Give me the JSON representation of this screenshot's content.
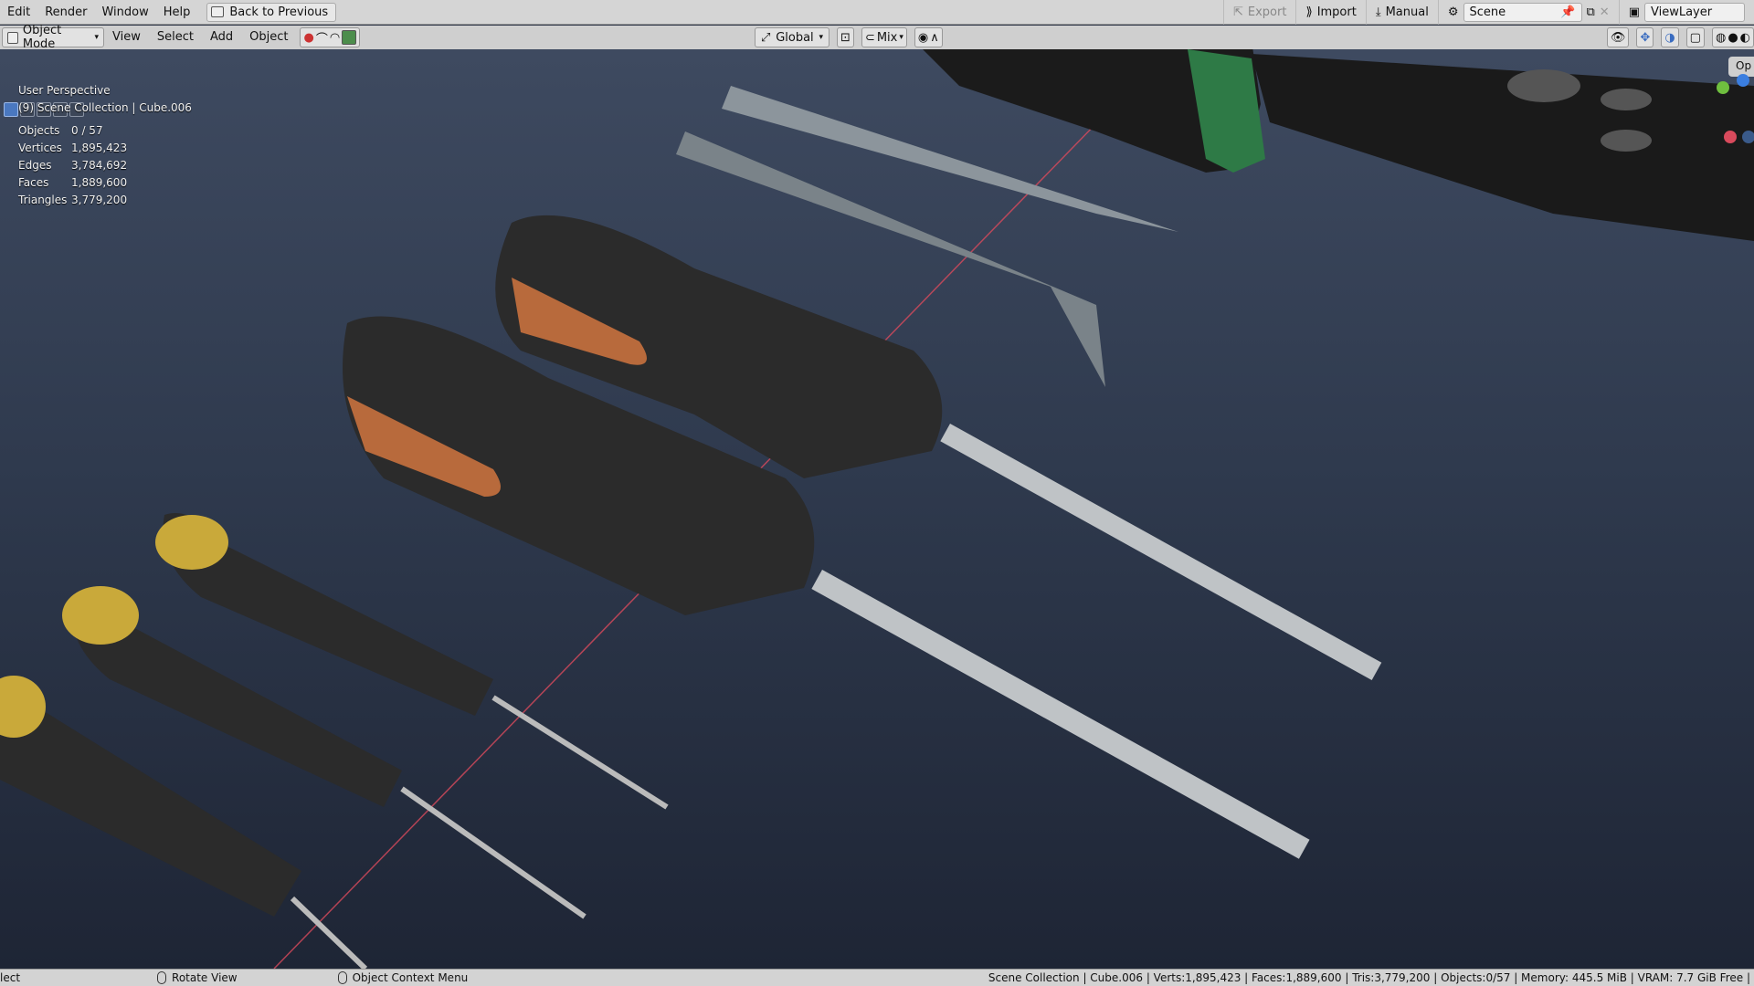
{
  "topbar": {
    "menus": [
      "Edit",
      "Render",
      "Window",
      "Help"
    ],
    "back_label": "Back to Previous",
    "export_label": "Export",
    "import_label": "Import",
    "manual_label": "Manual",
    "scene_name": "Scene",
    "viewlayer_name": "ViewLayer"
  },
  "header": {
    "mode_label": "Object Mode",
    "menus": [
      "View",
      "Select",
      "Add",
      "Object"
    ],
    "orientation_label": "Global",
    "blend_label": "Mix"
  },
  "viewport": {
    "view_name": "User Perspective",
    "collection_line": "(9) Scene Collection | Cube.006",
    "stats": [
      {
        "label": "Objects",
        "value": "0 / 57"
      },
      {
        "label": "Vertices",
        "value": "1,895,423"
      },
      {
        "label": "Edges",
        "value": "3,784,692"
      },
      {
        "label": "Faces",
        "value": "1,889,600"
      },
      {
        "label": "Triangles",
        "value": "3,779,200"
      }
    ],
    "op_label": "Op"
  },
  "statusbar": {
    "left_label": "lect",
    "rotate_label": "Rotate View",
    "context_label": "Object Context Menu",
    "stats_text": "Scene Collection | Cube.006 | Verts:1,895,423 | Faces:1,889,600 | Tris:3,779,200 | Objects:0/57 | Memory: 445.5 MiB | VRAM: 7.7 GiB Free |"
  },
  "colors": {
    "handle_dark": "#2b2b2b",
    "grip_orange": "#b86a3c",
    "grip_yellow": "#c9a93a",
    "knife_green": "#2e7a46",
    "x_axis": "#d94a5c"
  }
}
